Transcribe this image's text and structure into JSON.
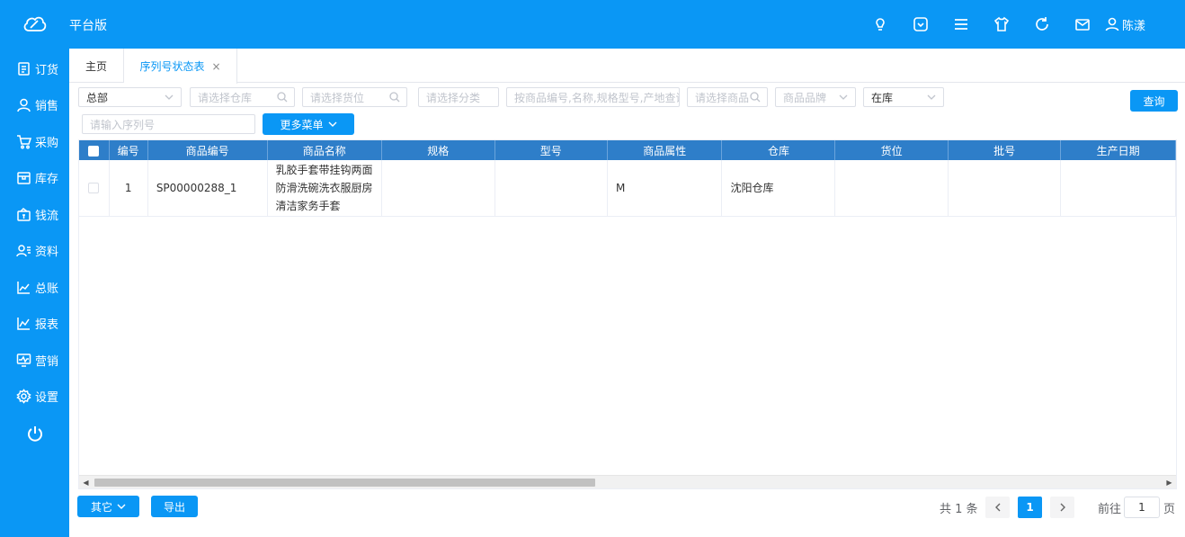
{
  "header": {
    "app_title": "平台版",
    "icons": [
      "bulb-icon",
      "chevron-box-icon",
      "menu-icon",
      "shirt-icon",
      "refresh-icon",
      "mail-icon"
    ],
    "user_name": "陈漾"
  },
  "sidebar": {
    "items": [
      {
        "label": "订货",
        "icon": "order-icon"
      },
      {
        "label": "销售",
        "icon": "user-icon"
      },
      {
        "label": "采购",
        "icon": "cart-icon"
      },
      {
        "label": "库存",
        "icon": "box-icon"
      },
      {
        "label": "钱流",
        "icon": "wallet-icon"
      },
      {
        "label": "资料",
        "icon": "profile-icon"
      },
      {
        "label": "总账",
        "icon": "ledger-chart-icon"
      },
      {
        "label": "报表",
        "icon": "report-chart-icon"
      },
      {
        "label": "营销",
        "icon": "monitor-icon"
      },
      {
        "label": "设置",
        "icon": "gear-icon"
      }
    ]
  },
  "tabs": {
    "home": "主页",
    "active": "序列号状态表",
    "close": "×"
  },
  "filters": {
    "scope_value": "总部",
    "warehouse_placeholder": "请选择仓库",
    "location_placeholder": "请选择货位",
    "category_placeholder": "请选择分类",
    "product_search_placeholder": "按商品编号,名称,规格型号,产地查询",
    "product_select_placeholder": "请选择商品",
    "brand_placeholder": "商品品牌",
    "status_value": "在库",
    "serial_placeholder": "请输入序列号",
    "more_menu": "更多菜单",
    "query": "查询"
  },
  "table": {
    "columns": [
      "编号",
      "商品编号",
      "商品名称",
      "规格",
      "型号",
      "商品属性",
      "仓库",
      "货位",
      "批号",
      "生产日期"
    ],
    "rows": [
      {
        "no": "1",
        "code": "SP00000288_1",
        "name": "乳胶手套带挂钩两面防滑洗碗洗衣服厨房清洁家务手套",
        "spec": "",
        "model": "",
        "attr": "M",
        "warehouse": "沈阳仓库",
        "location": "",
        "batch": "",
        "date": ""
      }
    ]
  },
  "footer": {
    "other": "其它",
    "export": "导出",
    "total": "共 1 条",
    "current_page": "1",
    "goto_label": "前往",
    "goto_value": "1",
    "page_unit": "页"
  },
  "colors": {
    "brand": "#0a97f5",
    "table_header": "#2e7ec9"
  }
}
